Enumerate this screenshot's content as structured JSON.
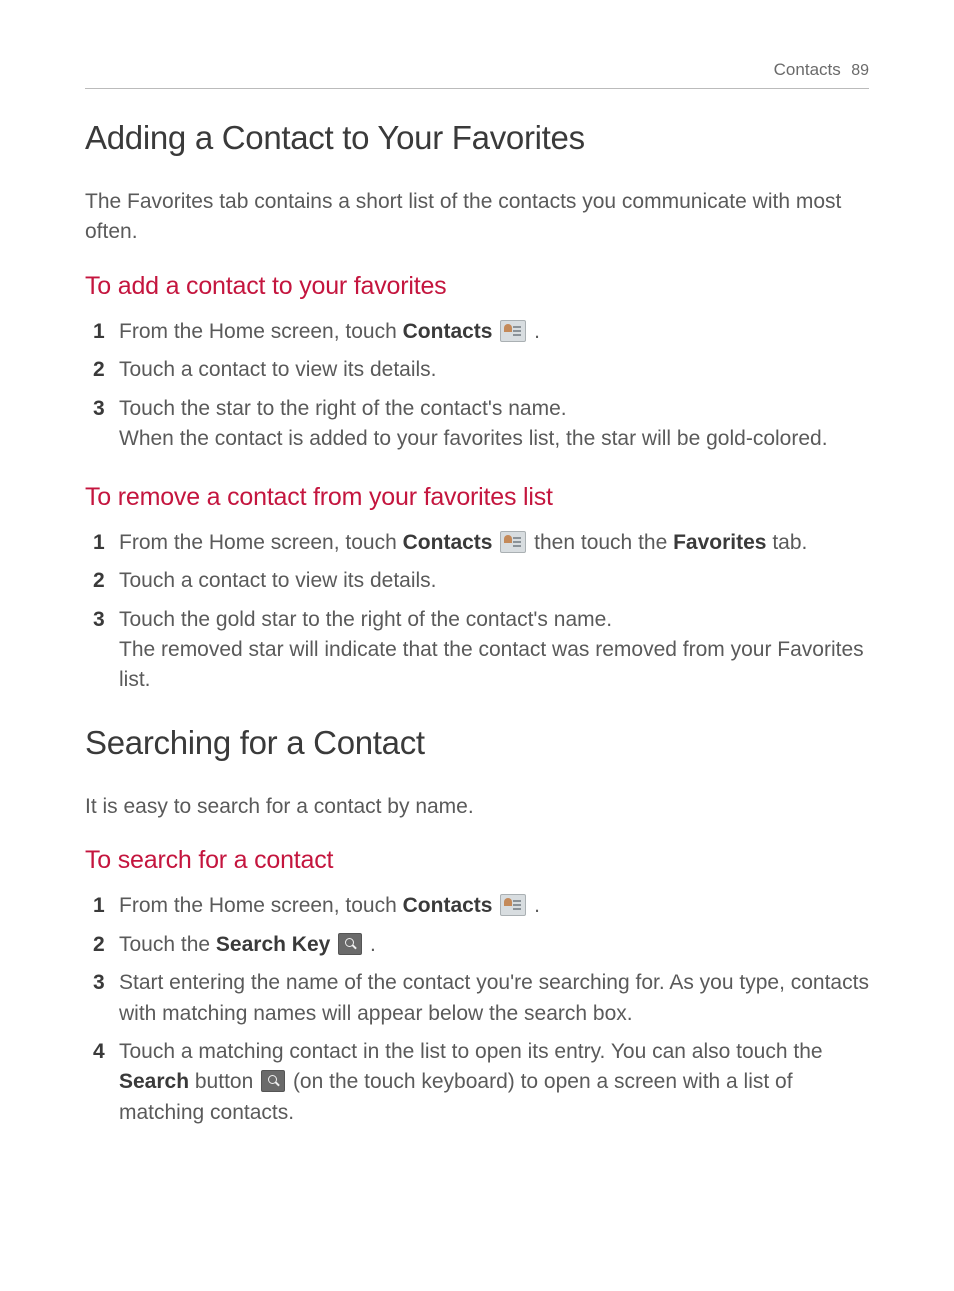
{
  "header": {
    "section": "Contacts",
    "page_number": "89"
  },
  "section1": {
    "title": "Adding a Contact to Your Favorites",
    "intro": "The Favorites tab contains a short list of the contacts you communicate with most often.",
    "sub1": {
      "heading": "To add a contact to your favorites",
      "steps": {
        "n1": "1",
        "s1a": " From the Home screen, touch ",
        "s1b": "Contacts",
        "s1c": " .",
        "n2": "2",
        "s2": " Touch a contact to view its details.",
        "n3": "3",
        "s3a": " Touch the star to the right of the contact's name.",
        "s3b": "When the contact is added to your favorites list, the star will be gold-colored."
      }
    },
    "sub2": {
      "heading": "To remove a contact from your favorites list",
      "steps": {
        "n1": "1",
        "s1a": " From the Home screen, touch ",
        "s1b": "Contacts",
        "s1c": " then touch the ",
        "s1d": "Favorites",
        "s1e": " tab.",
        "n2": "2",
        "s2": " Touch a contact to view its details.",
        "n3": "3",
        "s3a": " Touch the gold star to the right of the contact's name.",
        "s3b": "The removed star will indicate that the contact was removed from your Favorites list."
      }
    }
  },
  "section2": {
    "title": "Searching for a Contact",
    "intro": "It is easy to search for a contact by name.",
    "sub1": {
      "heading": "To search for a contact",
      "steps": {
        "n1": "1",
        "s1a": " From the Home screen, touch ",
        "s1b": "Contacts",
        "s1c": " .",
        "n2": "2",
        "s2a": " Touch the ",
        "s2b": "Search Key",
        "s2c": " .",
        "n3": "3",
        "s3": " Start entering the name of the contact you're searching for. As you type, contacts with matching names will appear below the search box.",
        "n4": "4",
        "s4a": " Touch a matching contact in the list to open its entry. You can also touch the ",
        "s4b": "Search",
        "s4c": " button ",
        "s4d": " (on the touch keyboard) to open a screen with a list of matching contacts."
      }
    }
  }
}
